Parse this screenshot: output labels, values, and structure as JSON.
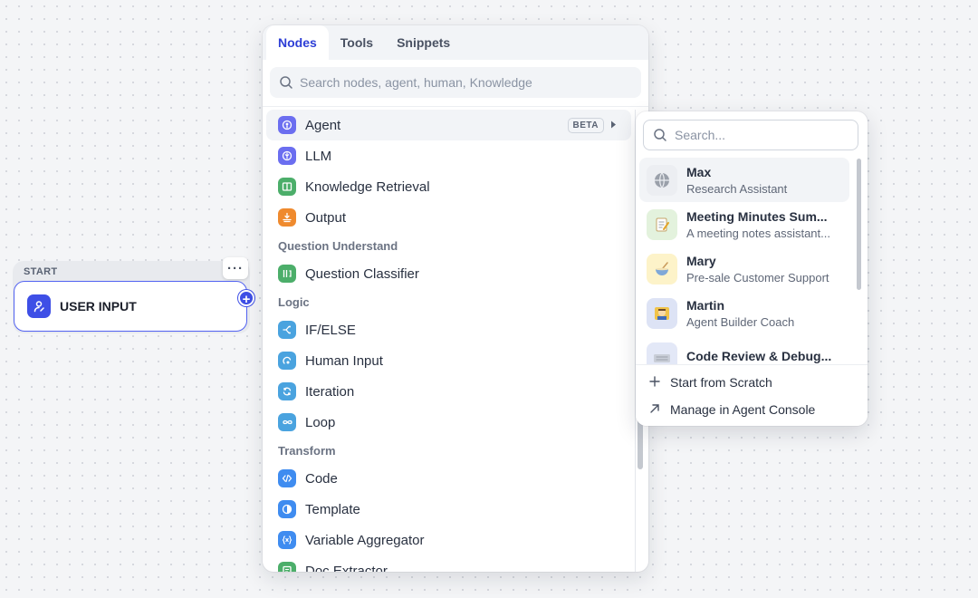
{
  "start_node": {
    "header": "START",
    "menu_label": "···",
    "title": "USER INPUT",
    "add_label": "+"
  },
  "panel": {
    "tabs": [
      {
        "label": "Nodes",
        "active": true
      },
      {
        "label": "Tools",
        "active": false
      },
      {
        "label": "Snippets",
        "active": false
      }
    ],
    "search_placeholder": "Search nodes, agent, human, Knowledge",
    "items": {
      "agent": {
        "label": "Agent",
        "badge": "BETA",
        "icon": "agent-icon",
        "color": "#6b6ef0"
      },
      "llm": {
        "label": "LLM",
        "icon": "llm-icon",
        "color": "#6b6ef0"
      },
      "knowledge": {
        "label": "Knowledge Retrieval",
        "icon": "book-icon",
        "color": "#4cae6a"
      },
      "output": {
        "label": "Output",
        "icon": "output-icon",
        "color": "#ef8a2e"
      },
      "question_classifier": {
        "label": "Question Classifier",
        "icon": "classifier-icon",
        "color": "#4cae6a"
      },
      "ifelse": {
        "label": "IF/ELSE",
        "icon": "branch-icon",
        "color": "#4aa3df"
      },
      "human_input": {
        "label": "Human Input",
        "icon": "human-icon",
        "color": "#4aa3df"
      },
      "iteration": {
        "label": "Iteration",
        "icon": "iteration-icon",
        "color": "#4aa3df"
      },
      "loop": {
        "label": "Loop",
        "icon": "loop-icon",
        "color": "#4aa3df"
      },
      "code": {
        "label": "Code",
        "icon": "code-icon",
        "color": "#3f8cf0"
      },
      "template": {
        "label": "Template",
        "icon": "template-icon",
        "color": "#3f8cf0"
      },
      "variable_aggregator": {
        "label": "Variable Aggregator",
        "icon": "variable-icon",
        "color": "#3f8cf0"
      },
      "doc_extractor": {
        "label": "Doc Extractor",
        "icon": "doc-icon",
        "color": "#4cae6a"
      }
    },
    "sections": {
      "question_understand": "Question Understand",
      "logic": "Logic",
      "transform": "Transform"
    }
  },
  "agent_menu": {
    "search_placeholder": "Search...",
    "agents": [
      {
        "name": "Max",
        "desc": "Research Assistant",
        "avatar": "globe-avatar",
        "bg": "#eceef2"
      },
      {
        "name": "Meeting Minutes Sum...",
        "desc": "A meeting notes assistant...",
        "avatar": "memo-avatar",
        "bg": "#e3f2dd"
      },
      {
        "name": "Mary",
        "desc": "Pre-sale Customer Support",
        "avatar": "bowl-avatar",
        "bg": "#fdf3c9"
      },
      {
        "name": "Martin",
        "desc": "Agent Builder Coach",
        "avatar": "person-avatar",
        "bg": "#dde3f5"
      },
      {
        "name": "Code Review & Debug...",
        "desc": "",
        "avatar": "keyboard-avatar",
        "bg": "#e3e8f7"
      }
    ],
    "footer": {
      "start_label": "Start from Scratch",
      "manage_label": "Manage in Agent Console"
    }
  }
}
